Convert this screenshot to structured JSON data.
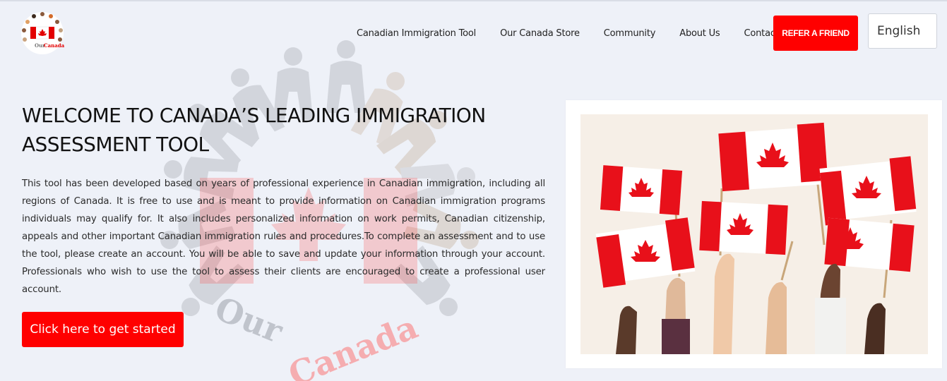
{
  "logo": {
    "text": "OurCanada",
    "icon": "people-circle-flag-logo"
  },
  "nav": {
    "items": [
      {
        "label": "Canadian Immigration Tool"
      },
      {
        "label": "Our Canada Store"
      },
      {
        "label": "Community"
      },
      {
        "label": "About Us"
      },
      {
        "label": "Contact Us"
      }
    ],
    "refer_label": "REFER A FRIEND",
    "language_value": "English"
  },
  "hero": {
    "title": "WELCOME TO CANADA’S LEADING IMMIGRATION ASSESSMENT TOOL",
    "description": "This tool has been developed based on years of professional experience in Canadian immigration, including all regions of Canada. It is free to use and is meant to provide information on Canadian immigration programs individuals may qualify for. It also includes personalized information on work permits, Canadian citizenship, appeals and other important Canadian immigration rules and procedures.To complete an assessment and to use the tool, please create an account. You will be able to save and update your information through your account. Professionals who wish to use the tool to assess their clients are encouraged to create a professional user account.",
    "cta_label": "Click here to get started"
  },
  "watermark_text": {
    "part1": "Our",
    "part2": "Canada"
  },
  "colors": {
    "accent": "#ff0000",
    "background": "#eef1f8",
    "text": "#111111"
  },
  "image": {
    "subject": "hands-waving-canadian-flags-photo"
  }
}
